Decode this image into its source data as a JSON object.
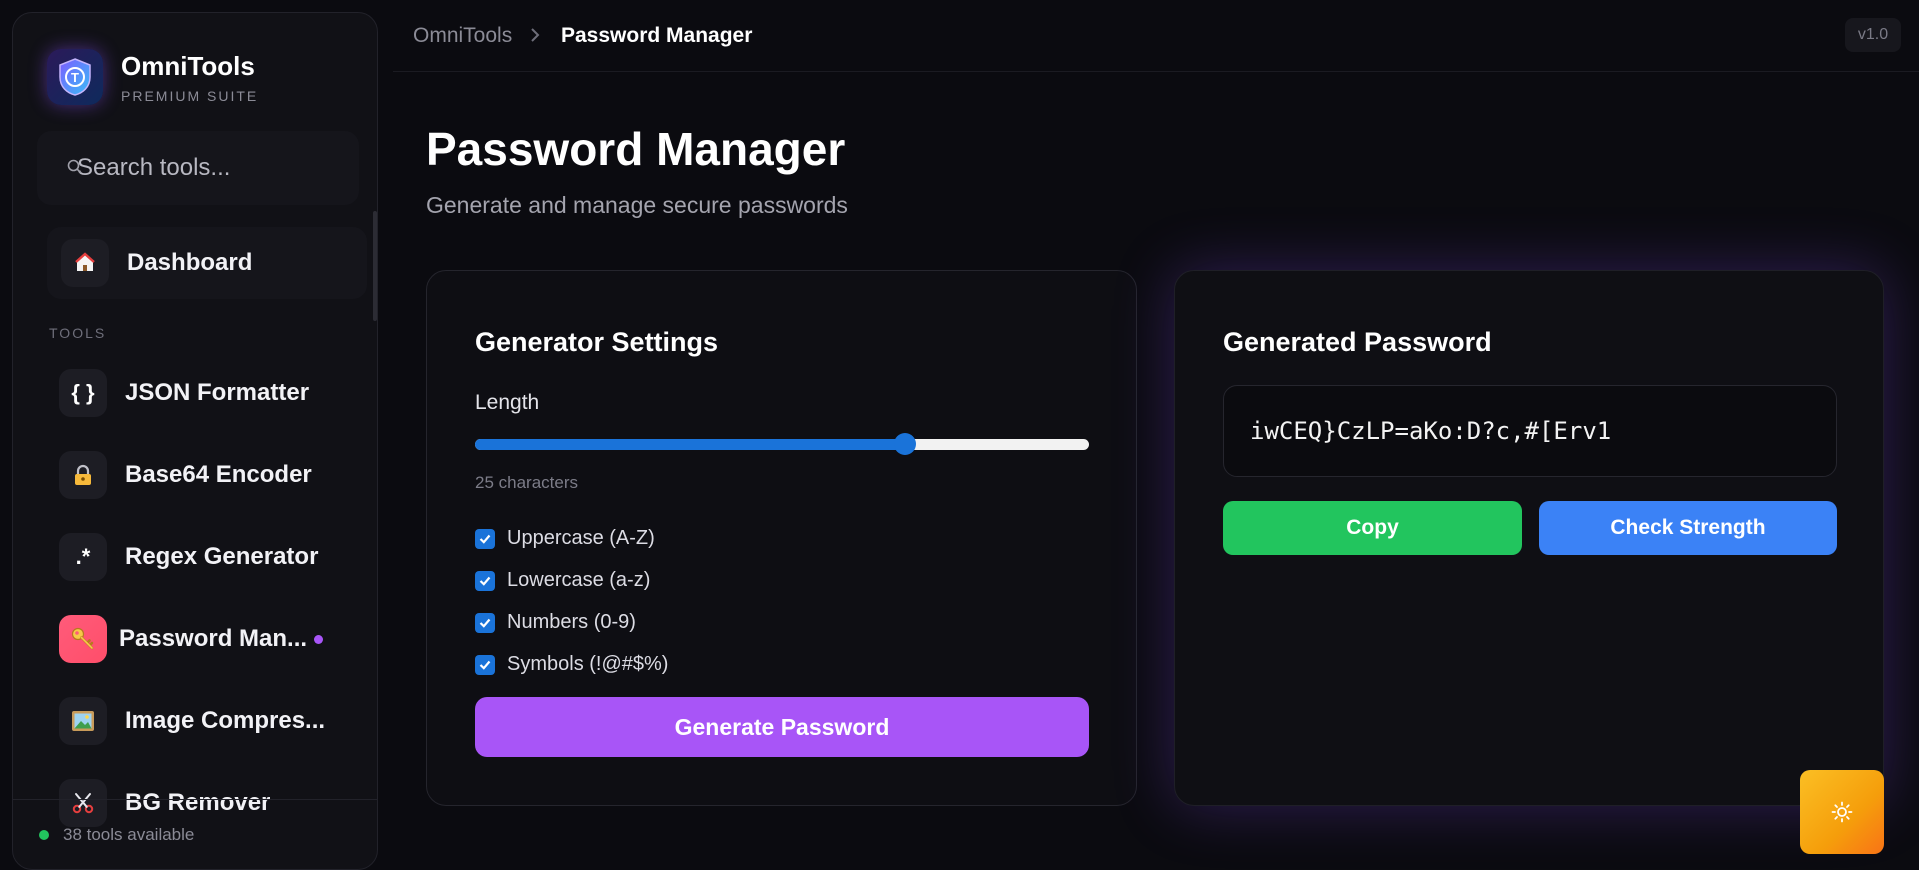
{
  "brand": {
    "name": "OmniTools",
    "subtitle": "PREMIUM SUITE"
  },
  "search": {
    "placeholder": "Search tools..."
  },
  "sidebar": {
    "dashboard": {
      "label": "Dashboard",
      "icon": "house-icon"
    },
    "section_label": "TOOLS",
    "items": [
      {
        "label": "JSON Formatter",
        "icon_text": "{ }",
        "icon": "braces-icon"
      },
      {
        "label": "Base64 Encoder",
        "icon_text": "🔐",
        "icon": "lock-icon"
      },
      {
        "label": "Regex Generator",
        "icon_text": ".*",
        "icon": "regex-icon"
      },
      {
        "label": "Password Man...",
        "icon_text": "🔑",
        "icon": "key-icon",
        "active": true
      },
      {
        "label": "Image Compres...",
        "icon_text": "🖼",
        "icon": "image-icon"
      },
      {
        "label": "BG Remover",
        "icon_text": "✂",
        "icon": "scissors-icon"
      }
    ],
    "footer": "38 tools available"
  },
  "breadcrumb": {
    "root": "OmniTools",
    "current": "Password Manager"
  },
  "version": "v1.0",
  "page": {
    "title": "Password Manager",
    "subtitle": "Generate and manage secure passwords"
  },
  "generator": {
    "title": "Generator Settings",
    "length_label": "Length",
    "length_fraction": 0.7,
    "char_count": "25 characters",
    "options": [
      {
        "label": "Uppercase (A-Z)",
        "checked": true
      },
      {
        "label": "Lowercase (a-z)",
        "checked": true
      },
      {
        "label": "Numbers (0-9)",
        "checked": true
      },
      {
        "label": "Symbols (!@#$%)",
        "checked": true
      }
    ],
    "generate_label": "Generate Password"
  },
  "output": {
    "title": "Generated Password",
    "password": "iwCEQ}CzLP=aKo:D?c,#[Erv1",
    "copy_label": "Copy",
    "strength_label": "Check Strength"
  },
  "colors": {
    "accent": "#a855f7",
    "copy": "#22c55e",
    "strength": "#3b82f6",
    "slider": "#1a73d9",
    "theme_button": "#fbbf24"
  }
}
